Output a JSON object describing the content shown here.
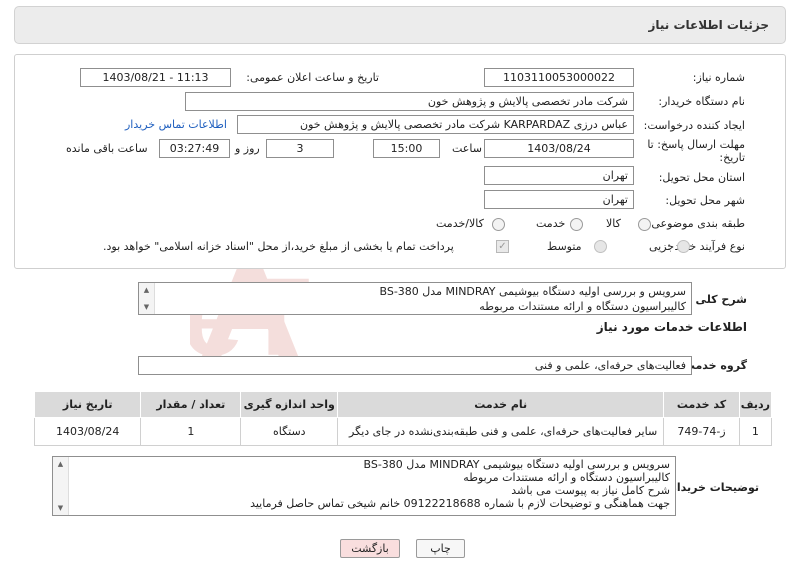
{
  "header": {
    "title": "جزئیات اطلاعات نیاز"
  },
  "form": {
    "need_number_label": "شماره نیاز:",
    "need_number": "1103110053000022",
    "announce_label": "تاریخ و ساعت اعلان عمومی:",
    "announce_value": "1403/08/21 - 11:13",
    "buyer_org_label": "نام دستگاه خریدار:",
    "buyer_org": "شرکت مادر تخصصی پالایش و پژوهش خون",
    "creator_label": "ایجاد کننده درخواست:",
    "creator": "عباس درزی KARPARDAZ شرکت مادر تخصصی پالایش و پژوهش خون",
    "contact_link": "اطلاعات تماس خریدار",
    "deadline_label_1": "مهلت ارسال پاسخ: تا",
    "deadline_label_2": "تاریخ:",
    "deadline_date": "1403/08/24",
    "time_label": "ساعت",
    "deadline_time": "15:00",
    "days_value": "3",
    "days_label": "روز و",
    "remaining_time": "03:27:49",
    "remaining_label": "ساعت باقی مانده",
    "province_label": "استان محل تحویل:",
    "province": "تهران",
    "city_label": "شهر محل تحویل:",
    "city": "تهران",
    "category_label": "طبقه بندی موضوعی:",
    "category_options": [
      "کالا",
      "خدمت",
      "کالا/خدمت"
    ],
    "process_label": "نوع فرآیند خرید :",
    "process_options": [
      "جزیی",
      "متوسط"
    ],
    "payment_note": "پرداخت تمام یا بخشی از مبلغ خرید،از محل \"اسناد خزانه اسلامی\" خواهد بود."
  },
  "summary": {
    "label": "شرح کلی نیاز:",
    "lines": [
      "سرویس و بررسی اولیه دستگاه بیوشیمی MINDRAY مدل BS-380",
      "کالیبراسیون دستگاه و ارائه مستندات مربوطه"
    ]
  },
  "services": {
    "section_title": "اطلاعات خدمات مورد نیاز",
    "group_label": "گروه خدمت:",
    "group_value": "فعالیت‌های حرفه‌ای، علمی و فنی",
    "columns": [
      "ردیف",
      "کد خدمت",
      "نام خدمت",
      "واحد اندازه گیری",
      "تعداد / مقدار",
      "تاریخ نیاز"
    ],
    "rows": [
      {
        "index": "1",
        "code": "ز-74-749",
        "name": "سایر فعالیت‌های حرفه‌ای، علمی و فنی طبقه‌بندی‌نشده در جای دیگر",
        "unit": "دستگاه",
        "quantity": "1",
        "date": "1403/08/24"
      }
    ]
  },
  "buyer_notes": {
    "label": "توضیحات خریدار:",
    "lines": [
      "سرویس و بررسی اولیه دستگاه بیوشیمی MINDRAY مدل BS-380",
      "کالیبراسیون دستگاه و ارائه مستندات مربوطه",
      "شرح کامل نیاز به پیوست می باشد",
      "جهت هماهنگی و توضیحات لازم با شماره 09122218688 خانم شیخی تماس حاصل فرمایید"
    ]
  },
  "buttons": {
    "print": "چاپ",
    "back": "بازگشت"
  },
  "watermark": {
    "text": "AriaTender.neT"
  },
  "colors": {
    "accent_link": "#1f5fbf",
    "watermark": "#c0392b",
    "back_button_bg": "#f9dede"
  }
}
